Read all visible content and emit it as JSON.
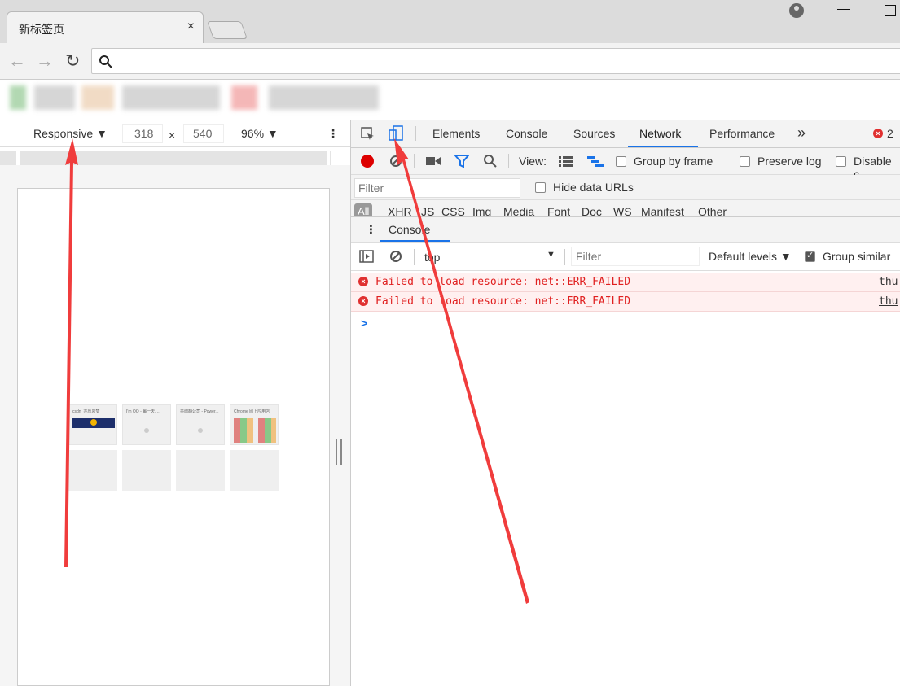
{
  "browser": {
    "tab_title": "新标签页",
    "tab_close": "×",
    "omnibox_value": "",
    "back_glyph": "←",
    "forward_glyph": "→",
    "reload_glyph": "↻"
  },
  "device_toolbar": {
    "device": "Responsive",
    "width": "318",
    "times": "×",
    "height": "540",
    "zoom": "96%",
    "more": "⋮"
  },
  "devtools": {
    "tabs": [
      "Elements",
      "Console",
      "Sources",
      "Network",
      "Performance"
    ],
    "active_tab": "Network",
    "more_tabs": "»",
    "error_count": "2",
    "network_toolbar": {
      "view_label": "View:",
      "group_by_frame": "Group by frame",
      "preserve_log": "Preserve log",
      "disable_cache": "Disable c"
    },
    "filter_placeholder": "Filter",
    "hide_data_urls": "Hide data URLs",
    "types": [
      "All",
      "XHR",
      "JS",
      "CSS",
      "Img",
      "Media",
      "Font",
      "Doc",
      "WS",
      "Manifest",
      "Other"
    ],
    "drawer_tab": "Console",
    "console_bar": {
      "context": "top",
      "filter_placeholder": "Filter",
      "levels": "Default levels",
      "group_similar": "Group similar"
    },
    "messages": [
      {
        "text": "Failed to load resource: net::ERR_FAILED",
        "source": "thu"
      },
      {
        "text": "Failed to load resource: net::ERR_FAILED",
        "source": "thu"
      }
    ],
    "prompt": ">"
  },
  "thumbs": [
    {
      "label": "csdn_亦愿思梦"
    },
    {
      "label": "I'm QQ - 每一天, ..."
    },
    {
      "label": "墨魂翻公司 - Power..."
    },
    {
      "label": "Chrome 网上应用店"
    }
  ],
  "colors": {
    "accent": "#1a73e8",
    "error": "#e02020",
    "record": "#dd0000",
    "annotation": "#f03c3c"
  }
}
